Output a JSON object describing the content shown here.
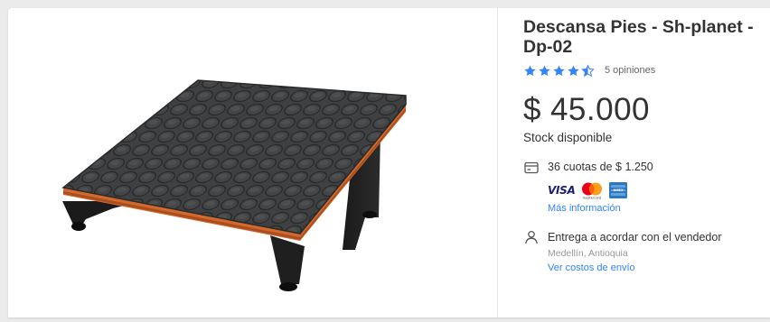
{
  "product": {
    "title": "Descansa Pies - Sh-planet - Dp-02",
    "rating": 4.5,
    "reviews_label": "5 opiniones",
    "price_symbol": "$",
    "price_amount": "45.000",
    "stock_label": "Stock disponible"
  },
  "payment": {
    "installments_label": "36 cuotas de $ 1.250",
    "visa_label": "VISA",
    "mastercard_label": "mastercard",
    "amex_label": "AMEX",
    "more_info_label": "Más información"
  },
  "shipping": {
    "delivery_label": "Entrega a acordar con el vendedor",
    "location": "Medellín, Antioquia",
    "costs_link": "Ver costos de envío"
  },
  "colors": {
    "accent": "#3483fa",
    "surface": "#ffffff",
    "background": "#ebebeb",
    "text": "#333333",
    "muted": "#999999",
    "product_mat": "#3f4041",
    "product_trim": "#d4692d"
  },
  "icons": {
    "stars": "star-icon",
    "installments": "credit-card-icon",
    "delivery": "person-icon"
  }
}
